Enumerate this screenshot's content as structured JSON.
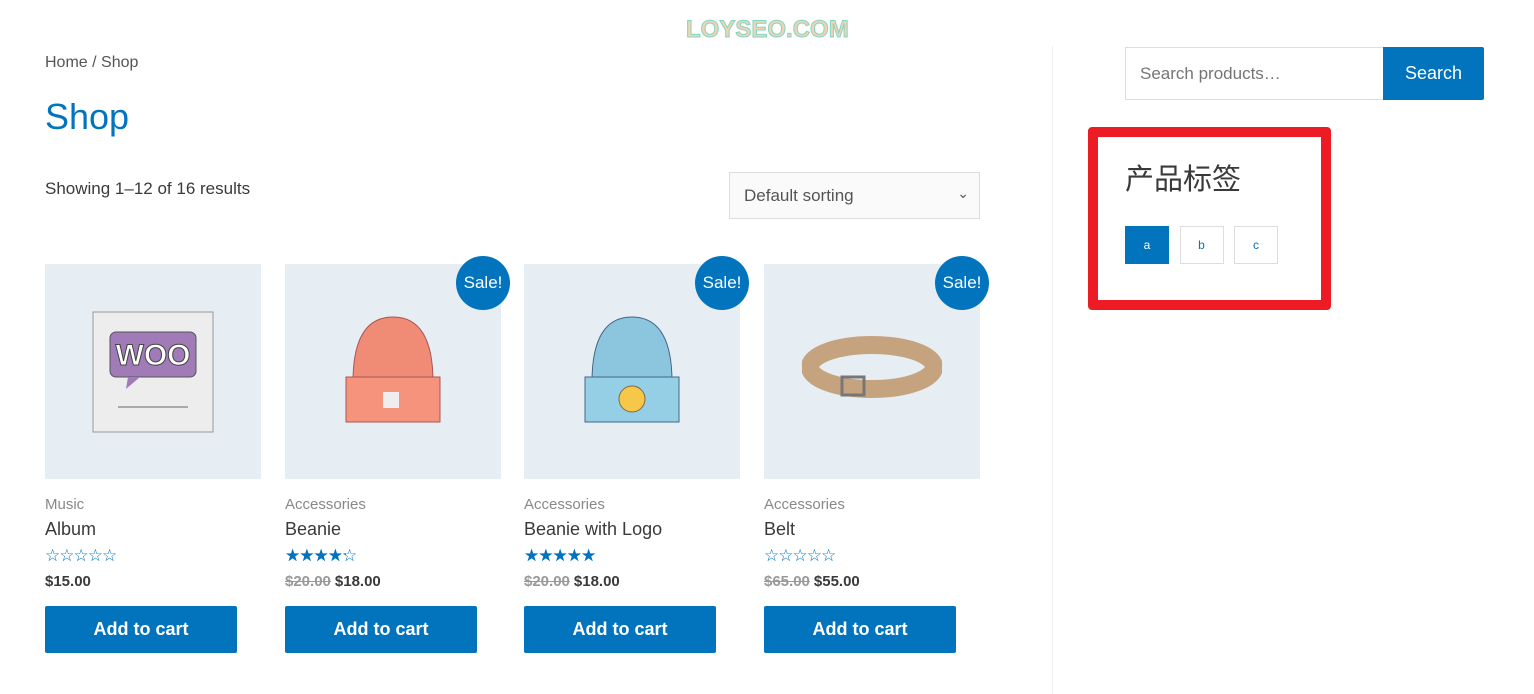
{
  "watermark": "LOYSEO.COM",
  "breadcrumb": "Home / Shop",
  "page_title": "Shop",
  "result_count": "Showing 1–12 of 16 results",
  "sorting": {
    "selected": "Default sorting"
  },
  "sale_badge": "Sale!",
  "add_to_cart": "Add to cart",
  "accent_color": "#0274be",
  "products": [
    {
      "category": "Music",
      "name": "Album",
      "rating": 0,
      "price": "$15.00",
      "sale": false
    },
    {
      "category": "Accessories",
      "name": "Beanie",
      "rating": 3.7,
      "old_price": "$20.00",
      "price": "$18.00",
      "sale": true
    },
    {
      "category": "Accessories",
      "name": "Beanie with Logo",
      "rating": 5,
      "old_price": "$20.00",
      "price": "$18.00",
      "sale": true
    },
    {
      "category": "Accessories",
      "name": "Belt",
      "rating": 0,
      "old_price": "$65.00",
      "price": "$55.00",
      "sale": true
    }
  ],
  "sidebar": {
    "search_placeholder": "Search products…",
    "search_button": "Search",
    "widget_title": "产品标签",
    "tags": [
      {
        "label": "a",
        "active": true
      },
      {
        "label": "b",
        "active": false
      },
      {
        "label": "c",
        "active": false
      }
    ]
  }
}
